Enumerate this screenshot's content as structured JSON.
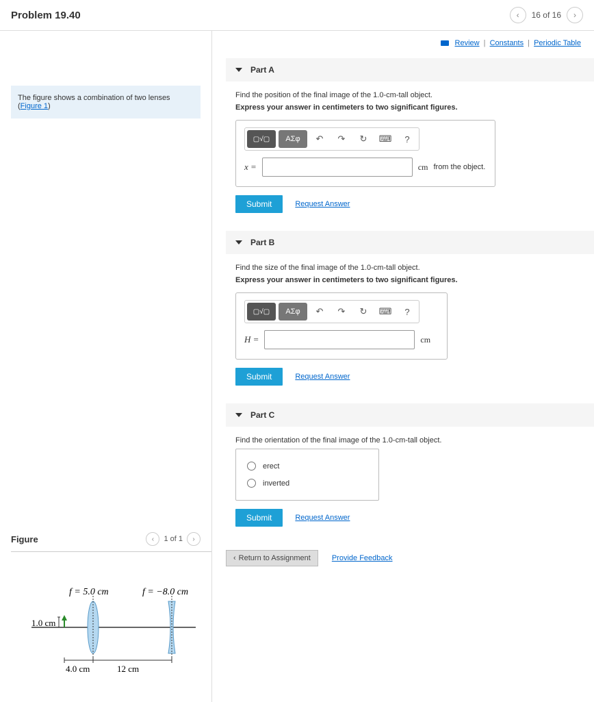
{
  "header": {
    "title": "Problem 19.40",
    "counter": "16 of 16"
  },
  "topLinks": {
    "review": "Review",
    "constants": "Constants",
    "periodic": "Periodic Table"
  },
  "prompt": {
    "textBefore": "The figure shows a combination of two lenses (",
    "link": "Figure 1",
    "textAfter": ")"
  },
  "figure": {
    "title": "Figure",
    "counter": "1 of 1",
    "lens1_f": "f = 5.0 cm",
    "lens2_f": "f = −8.0 cm",
    "object_h": "1.0 cm",
    "dist1": "4.0 cm",
    "dist2": "12 cm"
  },
  "toolbar": {
    "template": "▢√▢",
    "greek": "ΑΣφ",
    "undo": "↶",
    "redo": "↷",
    "reset": "↻",
    "keyboard": "⌨",
    "help": "?"
  },
  "partA": {
    "label": "Part A",
    "question": "Find the position of the final image of the 1.0-cm-tall object.",
    "instructions": "Express your answer in centimeters to two significant figures.",
    "var": "x =",
    "value": "",
    "unit": "cm",
    "suffix": "from the object.",
    "submit": "Submit",
    "request": "Request Answer"
  },
  "partB": {
    "label": "Part B",
    "question": "Find the size of the final image of the 1.0-cm-tall object.",
    "instructions": "Express your answer in centimeters to two significant figures.",
    "var": "H =",
    "value": "",
    "unit": "cm",
    "submit": "Submit",
    "request": "Request Answer"
  },
  "partC": {
    "label": "Part C",
    "question": "Find the orientation of the final image of the 1.0-cm-tall object.",
    "option1": "erect",
    "option2": "inverted",
    "submit": "Submit",
    "request": "Request Answer"
  },
  "bottom": {
    "return": "Return to Assignment",
    "feedback": "Provide Feedback"
  }
}
